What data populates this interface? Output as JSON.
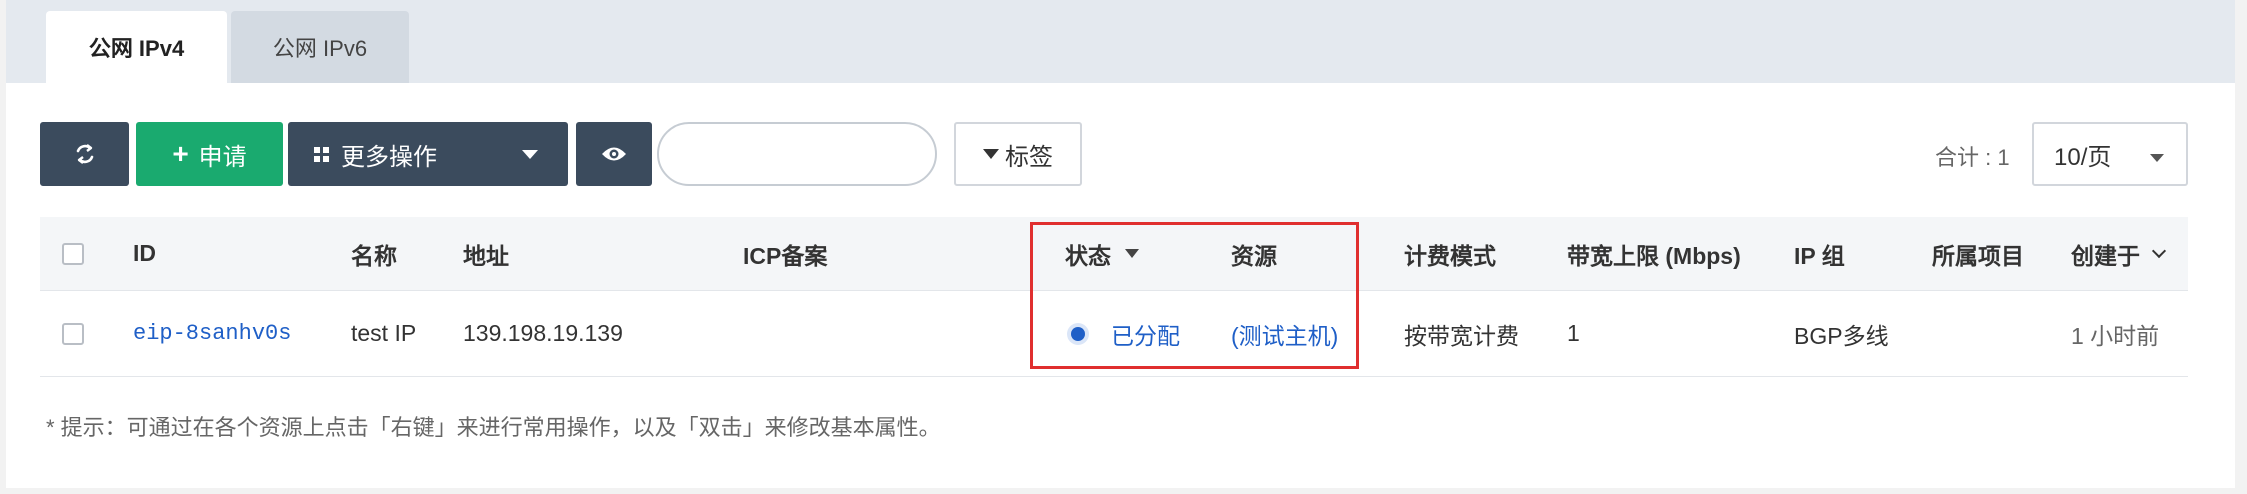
{
  "tabs": [
    {
      "label": "公网 IPv4",
      "active": true
    },
    {
      "label": "公网 IPv6",
      "active": false
    }
  ],
  "toolbar": {
    "refresh_icon": "refresh-icon",
    "apply_label": "申请",
    "more_label": "更多操作",
    "eye_icon": "eye-icon",
    "search_value": "",
    "search_placeholder": "",
    "tag_label": "标签",
    "total_label": "合计 : 1",
    "page_size": "10/页"
  },
  "table": {
    "columns": [
      "ID",
      "名称",
      "地址",
      "ICP备案",
      "状态",
      "资源",
      "计费模式",
      "带宽上限 (Mbps)",
      "IP 组",
      "所属项目",
      "创建于"
    ],
    "rows": [
      {
        "id": "eip-8sanhv0s",
        "name": "test IP",
        "address": "139.198.19.139",
        "icp": "",
        "status": "已分配",
        "resource": "(测试主机)",
        "billing": "按带宽计费",
        "bandwidth": "1",
        "ip_group": "BGP多线",
        "project": "",
        "created": "1 小时前"
      }
    ]
  },
  "hint": "* 提示：可通过在各个资源上点击「右键」来进行常用操作，以及「双击」来修改基本属性。",
  "colors": {
    "accent": "#1aaa6f",
    "dark": "#3b4b5d",
    "link": "#1f5fc7",
    "highlight": "#e02f2f"
  }
}
